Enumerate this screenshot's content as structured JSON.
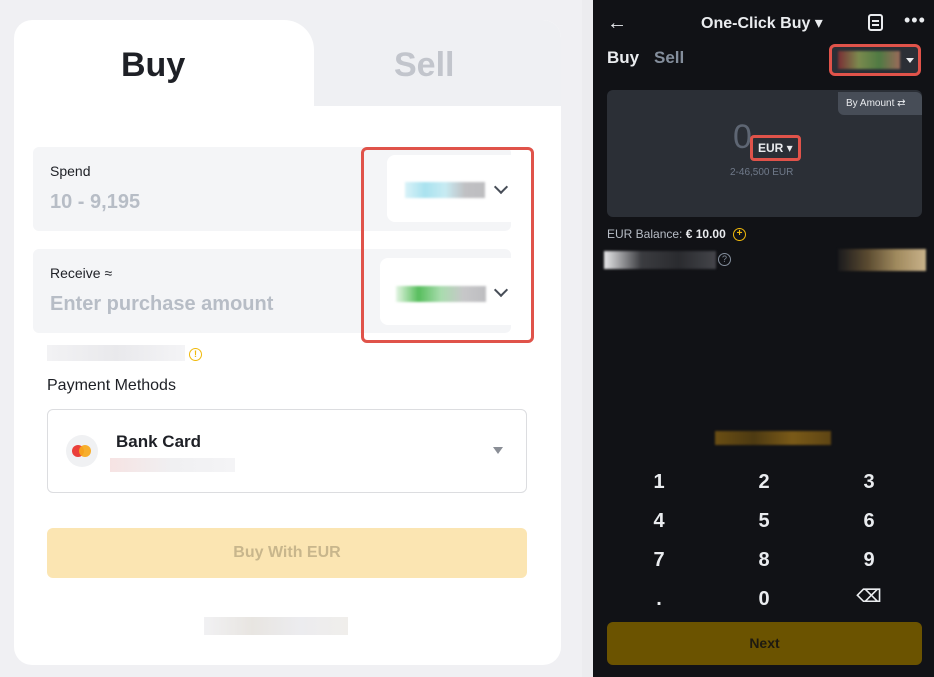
{
  "left": {
    "tabs": [
      {
        "label": "Buy"
      },
      {
        "label": "Sell"
      }
    ],
    "spend": {
      "label": "Spend",
      "placeholder": "10 - 9,195"
    },
    "receive": {
      "label": "Receive ≈",
      "placeholder": "Enter purchase amount"
    },
    "payment": {
      "title": "Payment Methods",
      "method": "Bank Card"
    },
    "buy_button": "Buy With EUR",
    "colors": {
      "accent_highlight": "#e0534a",
      "button_disabled": "#fbe5b2"
    }
  },
  "right": {
    "topbar": {
      "title": "One-Click Buy ▾",
      "back_icon": "←",
      "more_icon": "•••"
    },
    "tabs": [
      {
        "label": "Buy"
      },
      {
        "label": "Sell"
      }
    ],
    "by_amount": "By Amount ⇄",
    "amount": "0",
    "currency": "EUR ▾",
    "range": "2-46,500 EUR",
    "balance_label": "EUR Balance:",
    "balance_value": "€ 10.00",
    "keypad": [
      "1",
      "2",
      "3",
      "4",
      "5",
      "6",
      "7",
      "8",
      "9",
      ".",
      "0",
      "⌫"
    ],
    "next_button": "Next",
    "colors": {
      "bg": "#111216",
      "card": "#2b2f36",
      "accent": "#f0b90b"
    }
  }
}
